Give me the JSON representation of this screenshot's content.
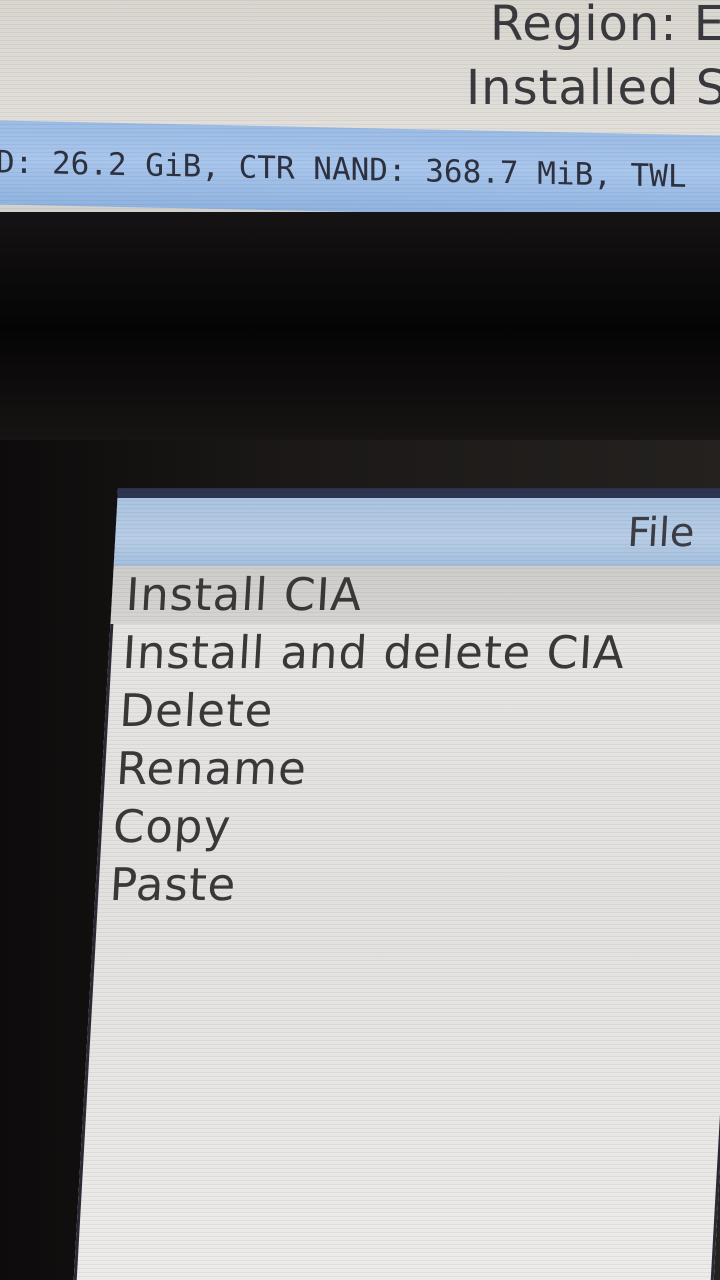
{
  "top_screen": {
    "region_label": "Region: E",
    "installed_label": "Installed Si",
    "status_bar_text": "D: 26.2 GiB, CTR NAND: 368.7 MiB, TWL"
  },
  "bottom_screen": {
    "menu_title": "File",
    "items": [
      {
        "label": "Install CIA",
        "selected": true
      },
      {
        "label": "Install and delete CIA",
        "selected": false
      },
      {
        "label": "Delete",
        "selected": false
      },
      {
        "label": "Rename",
        "selected": false
      },
      {
        "label": "Copy",
        "selected": false
      },
      {
        "label": "Paste",
        "selected": false
      }
    ]
  },
  "colors": {
    "header_blue": "#aac3e0",
    "status_blue": "#9bbce6",
    "selection_gray": "#d0cecc",
    "text_dark": "#3a3838"
  }
}
